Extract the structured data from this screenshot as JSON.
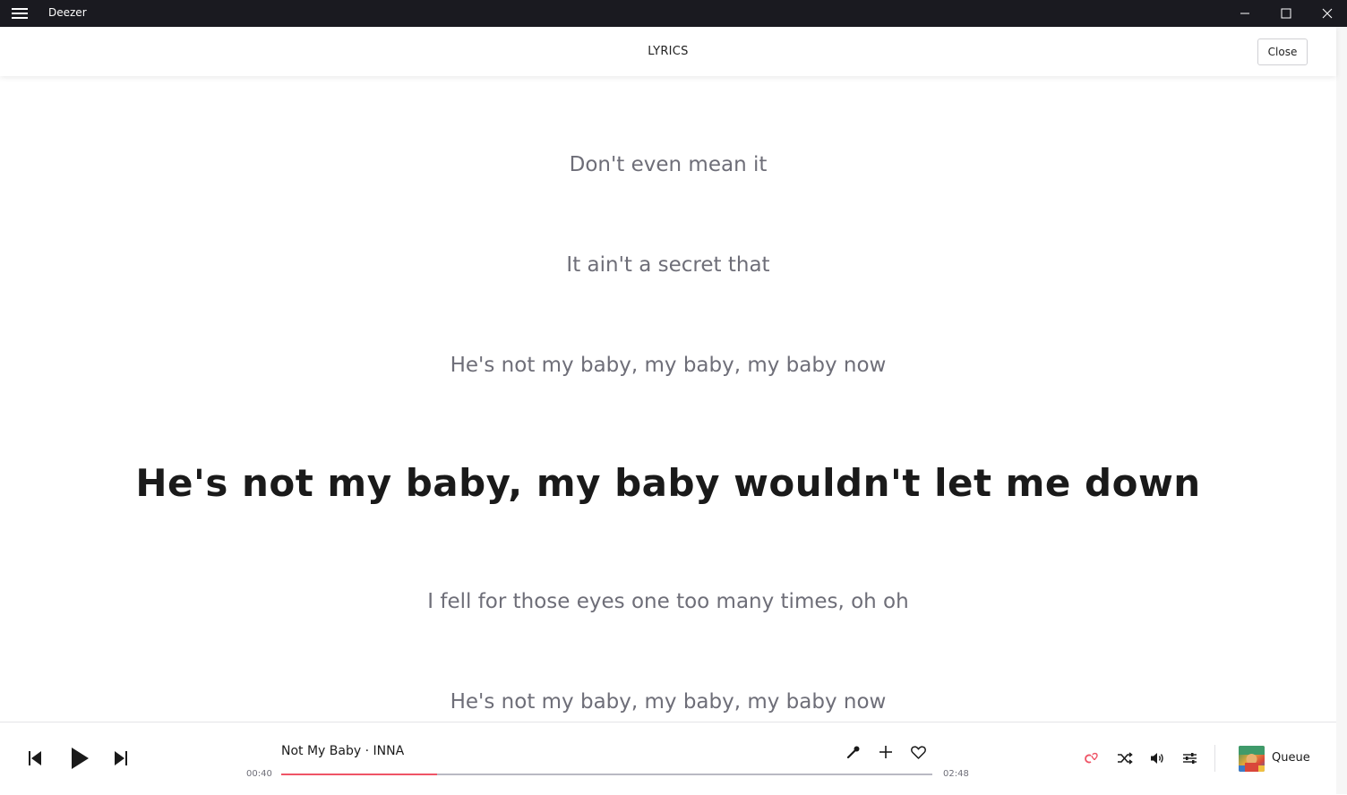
{
  "window": {
    "app_title": "Deezer",
    "menu_icon": "hamburger-icon",
    "controls": [
      "minimize-icon",
      "maximize-icon",
      "close-icon"
    ]
  },
  "header": {
    "title": "LYRICS",
    "close_label": "Close"
  },
  "lyrics": {
    "lines": [
      "Don't even mean it",
      "It ain't a secret that",
      "He's not my baby, my baby, my baby now",
      "He's not my baby, my baby wouldn't let me down",
      "I fell for those eyes one too many times, oh oh",
      "He's not my baby, my baby, my baby now"
    ],
    "active_index": 3
  },
  "player": {
    "track": "Not My Baby · INNA",
    "elapsed": "00:40",
    "duration": "02:48",
    "progress_fraction": 0.24,
    "queue_label": "Queue",
    "accent_color": "#ef5466",
    "icons": [
      "previous-icon",
      "play-icon",
      "next-icon",
      "microphone-icon",
      "add-icon",
      "heart-icon",
      "flow-icon",
      "shuffle-icon",
      "volume-icon",
      "equalizer-icon"
    ]
  }
}
